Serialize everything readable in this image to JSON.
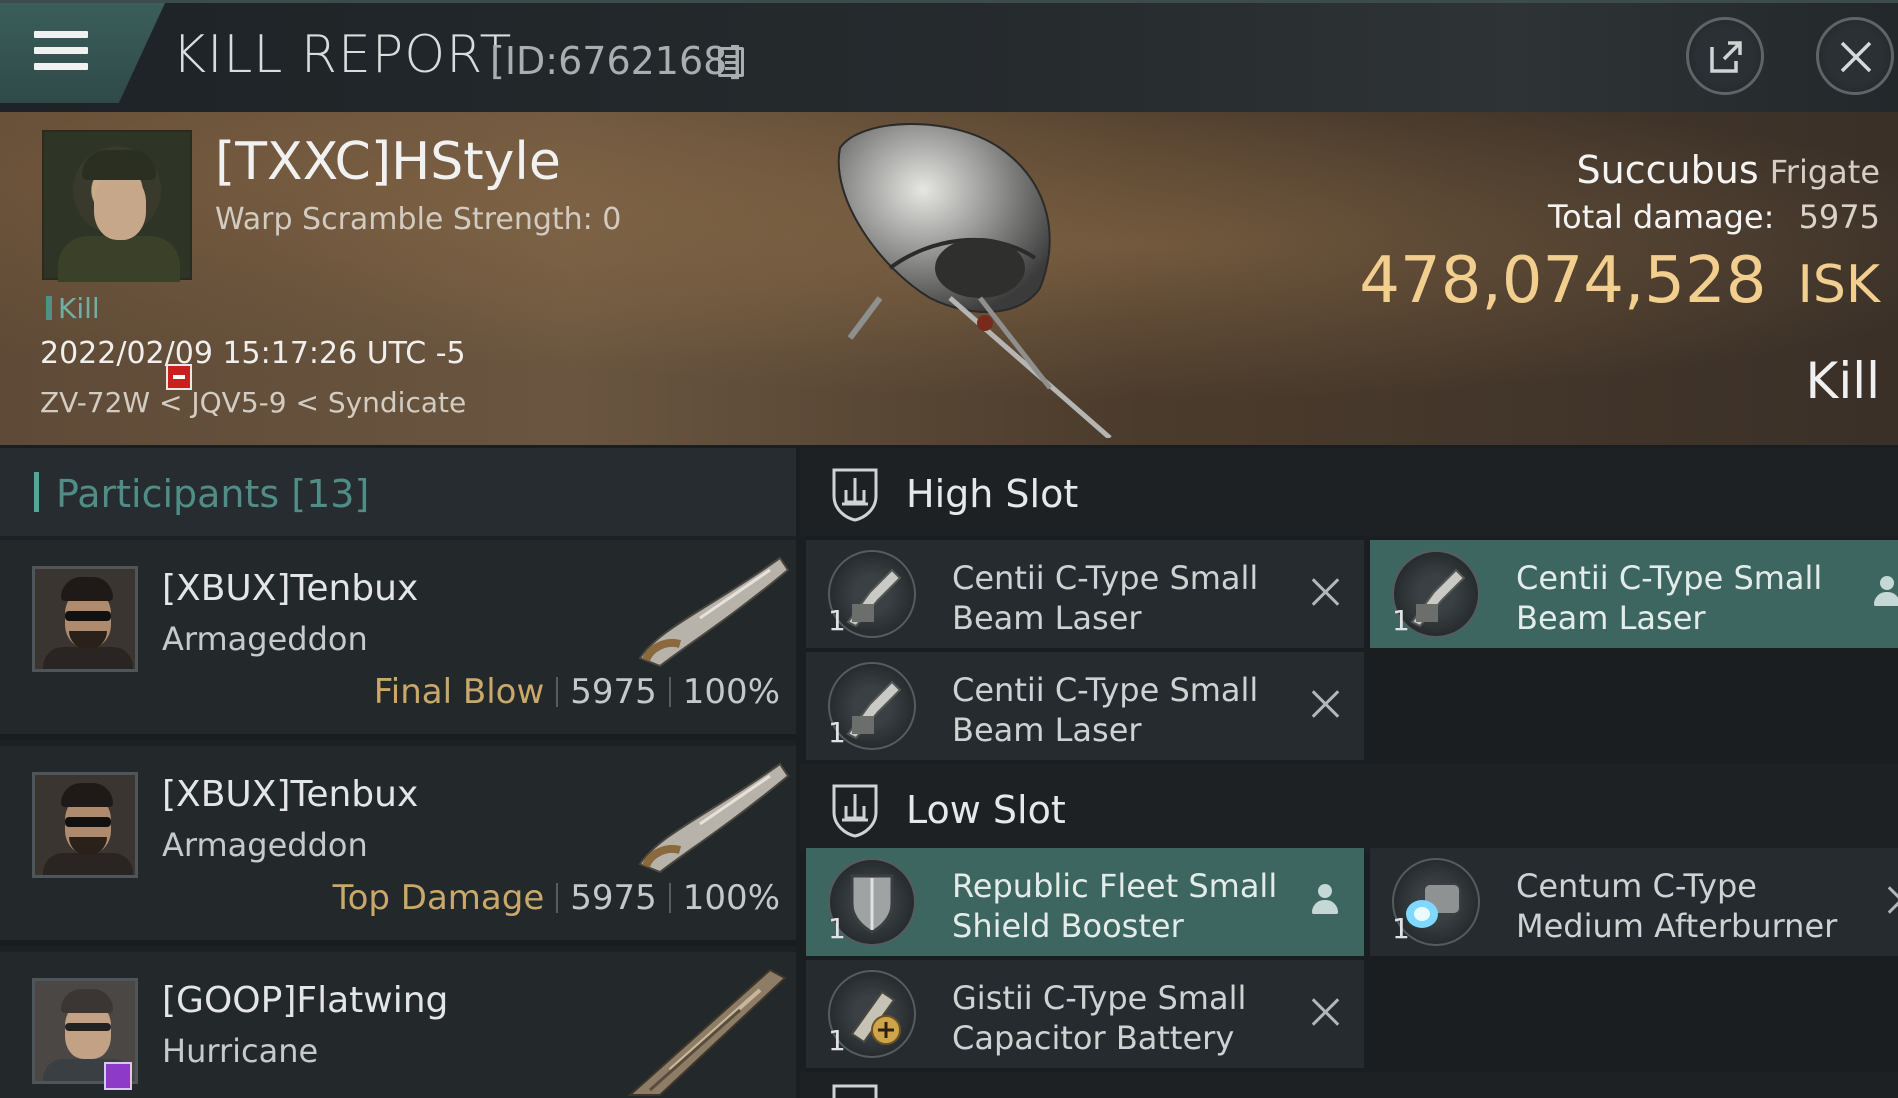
{
  "header": {
    "title": "KILL REPORT",
    "report_id": "[ID:6762168]"
  },
  "victim": {
    "name": "[TXXC]HStyle",
    "warp_scramble": "Warp Scramble Strength: 0",
    "result_tag": "Kill",
    "datetime": "2022/02/09 15:17:26 UTC -5",
    "location": "ZV-72W < JQV5-9 < Syndicate",
    "ship_name": "Succubus",
    "ship_class": "Frigate",
    "total_damage_label": "Total damage:",
    "total_damage": "5975",
    "isk_value": "478,074,528",
    "isk_unit": "ISK",
    "kill_type": "Kill"
  },
  "participants": {
    "label": "Participants [13]",
    "items": [
      {
        "name": "[XBUX]Tenbux",
        "ship": "Armageddon",
        "tag": "Final Blow",
        "damage": "5975",
        "percent": "100%"
      },
      {
        "name": "[XBUX]Tenbux",
        "ship": "Armageddon",
        "tag": "Top Damage",
        "damage": "5975",
        "percent": "100%"
      },
      {
        "name": "[GOOP]Flatwing",
        "ship": "Hurricane"
      }
    ]
  },
  "fitting": {
    "high_slot": {
      "label": "High Slot",
      "modules": [
        {
          "qty": "1",
          "name": "Centii C-Type Small Beam Laser",
          "status": "destroyed"
        },
        {
          "qty": "1",
          "name": "Centii C-Type Small Beam Laser",
          "status": "dropped"
        },
        {
          "qty": "1",
          "name": "Centii C-Type Small Beam Laser",
          "status": "destroyed"
        }
      ]
    },
    "low_slot": {
      "label": "Low Slot",
      "modules": [
        {
          "qty": "1",
          "name": "Republic Fleet Small Shield Booster",
          "status": "dropped"
        },
        {
          "qty": "1",
          "name": "Centum C-Type Medium Afterburner",
          "status": "destroyed"
        },
        {
          "qty": "1",
          "name": "Gistii C-Type Small Capacitor Battery",
          "status": "destroyed"
        }
      ]
    }
  },
  "colors": {
    "accent_teal": "#3d6661",
    "isk_gold": "#f2cf8e",
    "final_blow": "#c9a86a"
  }
}
